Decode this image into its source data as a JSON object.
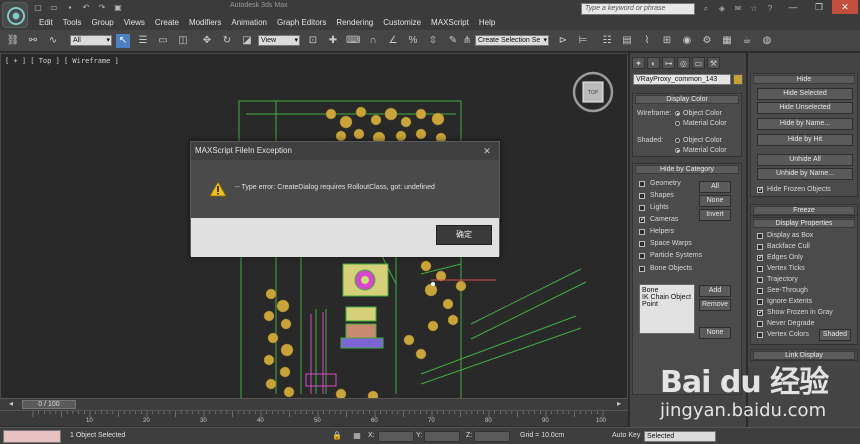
{
  "title_bar": {
    "app_title": "Autodesk 3ds Max",
    "search_placeholder": "Type a keyword or phrase",
    "quick_access": [
      "new-icon",
      "open-icon",
      "save-icon",
      "undo-icon",
      "redo-icon",
      "project-icon"
    ]
  },
  "menu": [
    "Edit",
    "Tools",
    "Group",
    "Views",
    "Create",
    "Modifiers",
    "Animation",
    "Graph Editors",
    "Rendering",
    "Customize",
    "MAXScript",
    "Help"
  ],
  "toolbar": {
    "selection_filter": "All",
    "reference_coord": "View",
    "named_selection": "Create Selection Se"
  },
  "viewport": {
    "label": "[ + ] [ Top ] [ Wireframe ]",
    "viewcube_label": "TOP"
  },
  "dialog": {
    "title": "MAXScript FileIn Exception",
    "message": "-- Type error: CreateDialog requires RolloutClass, got: undefined",
    "ok_label": "确定"
  },
  "command_panel": {
    "object_name": "VRayProxy_common_143",
    "display_color": {
      "title": "Display Color",
      "wireframe_label": "Wireframe:",
      "shaded_label": "Shaded:",
      "object_color": "Object Color",
      "material_color": "Material Color"
    },
    "hide_by_category": {
      "title": "Hide by Category",
      "categories": [
        "Geometry",
        "Shapes",
        "Lights",
        "Cameras",
        "Helpers",
        "Space Warps",
        "Particle Systems",
        "Bone Objects"
      ],
      "checked": [
        false,
        false,
        false,
        true,
        false,
        false,
        false,
        false
      ],
      "all_label": "All",
      "none_label": "None",
      "invert_label": "Invert",
      "list_items": [
        "Bone",
        "IK Chain Object",
        "Point"
      ],
      "add_label": "Add",
      "remove_label": "Remove",
      "none2_label": "None"
    }
  },
  "right_panel": {
    "hide_title": "Hide",
    "hide_buttons": [
      "Hide Selected",
      "Hide Unselected",
      "Hide by Name...",
      "Hide by Hit"
    ],
    "unhide_buttons": [
      "Unhide All",
      "Unhide by Name..."
    ],
    "hide_frozen": "Hide Frozen Objects",
    "freeze_title": "Freeze",
    "display_props_title": "Display Properties",
    "display_props": [
      "Display as Box",
      "Backface Cull",
      "Edges Only",
      "Vertex Ticks",
      "Trajectory",
      "See-Through",
      "Ignore Extents",
      "Show Frozen in Gray",
      "Never Degrade",
      "Vertex Colors"
    ],
    "display_props_checked": [
      false,
      false,
      true,
      false,
      false,
      false,
      false,
      true,
      false,
      false
    ],
    "shaded_label": "Shaded",
    "link_display_title": "Link Display"
  },
  "timeline": {
    "slider_label": "0 / 100",
    "ticks": [
      "10",
      "20",
      "30",
      "40",
      "50",
      "60",
      "70",
      "80",
      "90",
      "100"
    ]
  },
  "status": {
    "text": "1 Object Selected",
    "x_label": "X:",
    "y_label": "Y:",
    "z_label": "Z:",
    "grid": "Grid = 10.0cm",
    "auto_key": "Auto Key",
    "selection_mode": "Selected"
  },
  "watermark": {
    "brand": "Bai du 经验",
    "url": "jingyan.baidu.com"
  },
  "colors": {
    "wire_green": "#3fae3f",
    "tree_yellow": "#c9a43a",
    "pink": "#d648c8",
    "warning": "#f0c020"
  }
}
